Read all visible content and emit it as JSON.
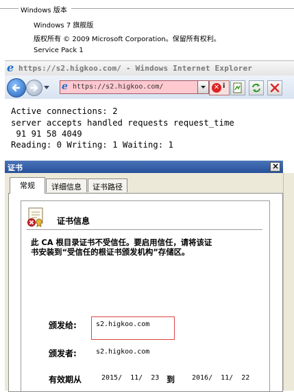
{
  "winver": {
    "title": "Windows 版本",
    "edition": "Windows 7 旗舰版",
    "copyright": "版权所有 © 2009 Microsoft Corporation。保留所有权利。",
    "service_pack": "Service Pack 1"
  },
  "browser": {
    "title": "https://s2.higkoo.com/ - Windows Internet Explorer",
    "address_value": "https://s2.higkoo.com/",
    "cert_error_letter": "i",
    "address_bar_color": "#ffc9d0",
    "icons": [
      "ie-logo-icon",
      "back-arrow-icon",
      "forward-arrow-icon",
      "dropdown-arrow-icon",
      "cert-error-icon",
      "compatibility-view-icon",
      "refresh-icon",
      "stop-icon"
    ]
  },
  "nginx_status": {
    "line1": "Active connections: 2",
    "line2": "server accepts handled requests request_time",
    "line3": " 91 91 58 4049",
    "line4": "Reading: 0 Writing: 1 Waiting: 1"
  },
  "certificate_dialog": {
    "title": "证书",
    "tabs": [
      {
        "label": "常规",
        "active": true
      },
      {
        "label": "详细信息",
        "active": false
      },
      {
        "label": "证书路径",
        "active": false
      }
    ],
    "header": "证书信息",
    "warning_line1": "此 CA 根目录证书不受信任。要启用信任，请将该证",
    "warning_line2": "书安装到“受信任的根证书颁发机构”存储区。",
    "issued_to_label": "颁发给:",
    "issued_to_value": "s2.higkoo.com",
    "issued_by_label": "颁发者:",
    "issued_by_value": "s2.higkoo.com",
    "valid_label": "有效期从",
    "valid_from": "2015/  11/  23",
    "valid_to_word": "到",
    "valid_to": "2016/  11/  22"
  }
}
